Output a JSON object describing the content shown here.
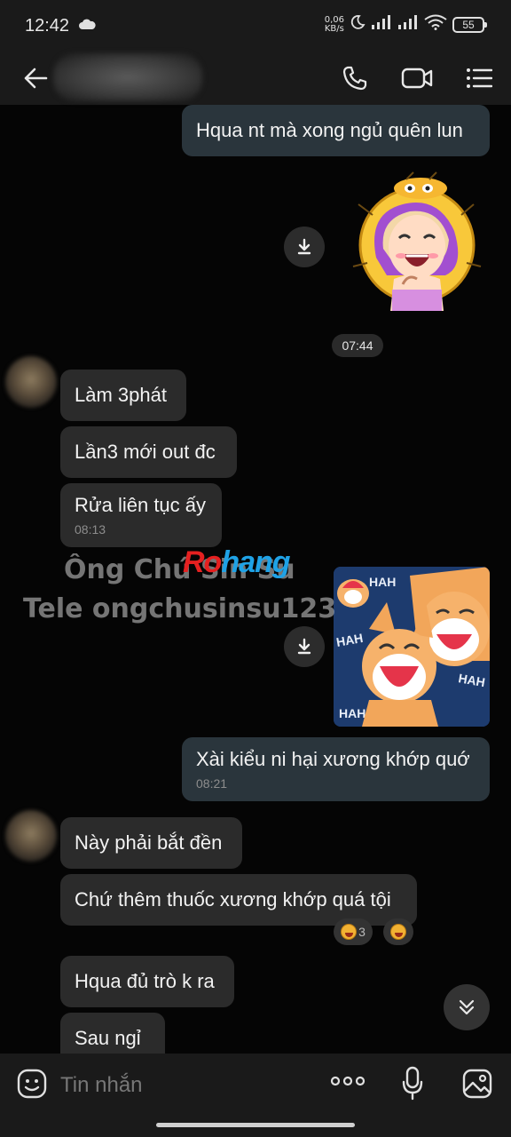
{
  "status_bar": {
    "time": "12:42",
    "net_speed_value": "0,06",
    "net_speed_unit": "KB/s",
    "battery": "55"
  },
  "header": {
    "contact_name": ""
  },
  "messages": [
    {
      "text": "Hqua nt mà xong ngủ quên lun"
    },
    {
      "time": "07:44"
    },
    {
      "text": "Làm 3phát"
    },
    {
      "text": "Lần3 mới out đc"
    },
    {
      "text": "Rửa liên tục ấy",
      "time": "08:13"
    },
    {
      "text": "Xài kiểu ni hại xương khớp quớ",
      "time": "08:21"
    },
    {
      "text": "Này phải bắt đền"
    },
    {
      "text": "Chứ thêm thuốc xương khớp quá tội"
    },
    {
      "text": "Hqua đủ trò k ra"
    },
    {
      "text": "Sau ngỉ"
    }
  ],
  "reactions": [
    {
      "icon": "laughing-face",
      "count": "3"
    },
    {
      "icon": "laughing-face",
      "count": ""
    }
  ],
  "watermark": {
    "line1": "Ông Chú Sin Su",
    "line2": "Tele ongchusinsu123",
    "brand_part1": "Ro",
    "brand_part2": "hang"
  },
  "stickers": [
    {
      "name": "girl-laughing-sticker",
      "text": ""
    },
    {
      "name": "fox-laughing-sticker",
      "text": "HAH"
    }
  ],
  "input": {
    "placeholder": "Tin nhắn"
  },
  "colors": {
    "background": "#050505",
    "bar": "#1a1a1a",
    "outgoing_bubble": "#2a353c",
    "incoming_bubble": "#2b2b2b"
  }
}
